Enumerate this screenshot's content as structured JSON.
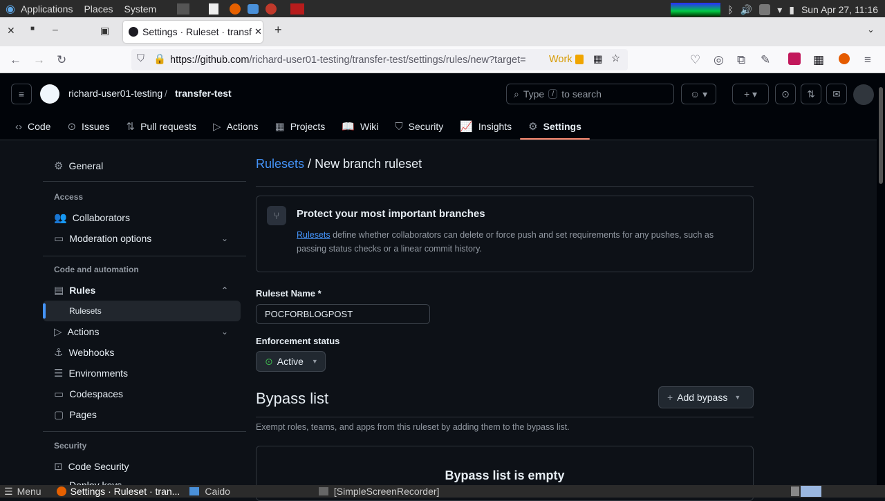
{
  "os": {
    "apps_label": "Applications",
    "places_label": "Places",
    "system_label": "System",
    "clock": "Sun Apr 27, 11:16"
  },
  "browser": {
    "tab_title": "Settings · Ruleset · transfer-test",
    "url_host": "https://github.com",
    "url_path": "/richard-user01-testing/transfer-test/settings/rules/new?target=",
    "container_label": "Work"
  },
  "header": {
    "owner": "richard-user01-testing",
    "separator": "/",
    "repo": "transfer-test",
    "search_placeholder_pre": "Type",
    "search_key": "/",
    "search_placeholder_post": "to search"
  },
  "repo_nav": [
    {
      "label": "Code",
      "icon": "‹›"
    },
    {
      "label": "Issues",
      "icon": "⊙"
    },
    {
      "label": "Pull requests",
      "icon": "⇅"
    },
    {
      "label": "Actions",
      "icon": "▷"
    },
    {
      "label": "Projects",
      "icon": "▦"
    },
    {
      "label": "Wiki",
      "icon": "📖"
    },
    {
      "label": "Security",
      "icon": "⛉"
    },
    {
      "label": "Insights",
      "icon": "📈"
    },
    {
      "label": "Settings",
      "icon": "⚙"
    }
  ],
  "sidebar": {
    "general": "General",
    "access_heading": "Access",
    "collaborators": "Collaborators",
    "moderation": "Moderation options",
    "code_heading": "Code and automation",
    "rules": "Rules",
    "rulesets": "Rulesets",
    "actions": "Actions",
    "webhooks": "Webhooks",
    "environments": "Environments",
    "codespaces": "Codespaces",
    "pages": "Pages",
    "security_heading": "Security",
    "code_security": "Code Security",
    "deploy_keys": "Deploy keys"
  },
  "main": {
    "breadcrumb_link": "Rulesets",
    "breadcrumb_sep": "/",
    "breadcrumb_title": "New branch ruleset",
    "info_title": "Protect your most important branches",
    "info_link": "Rulesets",
    "info_text_1": " define whether collaborators can delete or force push and set requirements for any pushes, such as",
    "info_text_2": "passing status checks or a linear commit history.",
    "name_label": "Ruleset Name *",
    "name_value": "POCFORBLOGPOST",
    "enforcement_label": "Enforcement status",
    "enforcement_value": "Active",
    "bypass_title": "Bypass list",
    "add_bypass": "Add bypass",
    "bypass_desc": "Exempt roles, teams, and apps from this ruleset by adding them to the bypass list.",
    "bypass_empty": "Bypass list is empty"
  },
  "taskbar": {
    "menu": "Menu",
    "task1": "Settings · Ruleset · tran...",
    "task2": "Caido",
    "task3": "[SimpleScreenRecorder]"
  }
}
